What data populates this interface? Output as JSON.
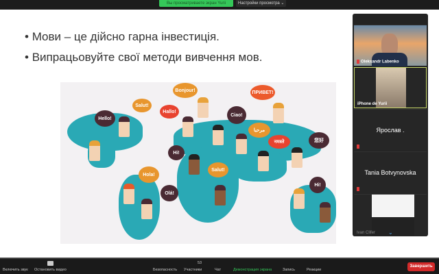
{
  "top": {
    "viewing_banner": "Вы просматриваете экран Yurii",
    "view_options": "Настройки просмотра ⌄"
  },
  "slide": {
    "bullets": [
      "Мови – це дійсно гарна інвестиція.",
      "Випрацьовуйте свої методи вивчення мов."
    ],
    "bubbles": [
      "Hello!",
      "Salut!",
      "Bonjour!",
      "Hallo!",
      "Ciao!",
      "ПРИВЕТ!",
      "مرحبا",
      "नमस्ते",
      "您好",
      "Hi!",
      "Salut!",
      "Hola!",
      "Olá!",
      "Hi!"
    ]
  },
  "participants": [
    {
      "name": "Oleksandr Labenko"
    },
    {
      "name": "iPhone de Yurii"
    },
    {
      "name": "Ярослав ."
    },
    {
      "name": "Tania Botvynovska"
    },
    {
      "name": "Ivan Clifer"
    }
  ],
  "toolbar": {
    "unmute": "Включить звук",
    "stop_video": "Остановить видео",
    "security": "Безопасность",
    "participants": "Участники",
    "participants_count": "53",
    "chat": "Чат",
    "share": "Демонстрация экрана",
    "record": "Запись",
    "reactions": "Реакции",
    "end": "Завершить"
  },
  "colors": {
    "share_green": "#35c759",
    "end_red": "#d22a2a",
    "land": "#2aa9b5"
  }
}
